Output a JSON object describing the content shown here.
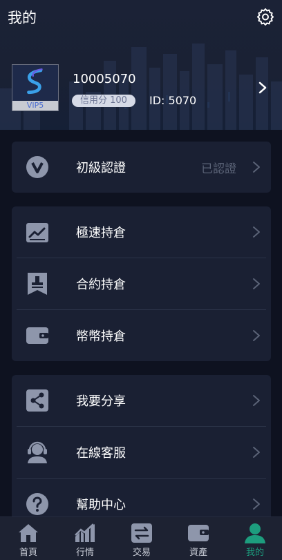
{
  "header": {
    "title": "我的",
    "user_id": "10005070",
    "credit_label": "信用分 100",
    "id_label": "ID: 5070",
    "vip_label": "VIP5"
  },
  "verify": {
    "label": "初級認證",
    "status": "已認證"
  },
  "holdings": [
    {
      "label": "極速持倉",
      "icon": "chart-up-icon"
    },
    {
      "label": "合約持倉",
      "icon": "stamp-icon"
    },
    {
      "label": "幣幣持倉",
      "icon": "wallet-icon"
    }
  ],
  "services": [
    {
      "label": "我要分享",
      "icon": "share-icon"
    },
    {
      "label": "在線客服",
      "icon": "headset-icon"
    },
    {
      "label": "幫助中心",
      "icon": "help-icon"
    }
  ],
  "tabs": [
    {
      "label": "首頁",
      "icon": "home-icon"
    },
    {
      "label": "行情",
      "icon": "market-icon"
    },
    {
      "label": "交易",
      "icon": "exchange-icon"
    },
    {
      "label": "資產",
      "icon": "wallet-icon"
    },
    {
      "label": "我的",
      "icon": "user-icon",
      "active": true
    }
  ],
  "colors": {
    "background": "#0e1220",
    "card": "#1a2033",
    "accent": "#1d9d7e",
    "icon_muted": "#8e96ab"
  }
}
